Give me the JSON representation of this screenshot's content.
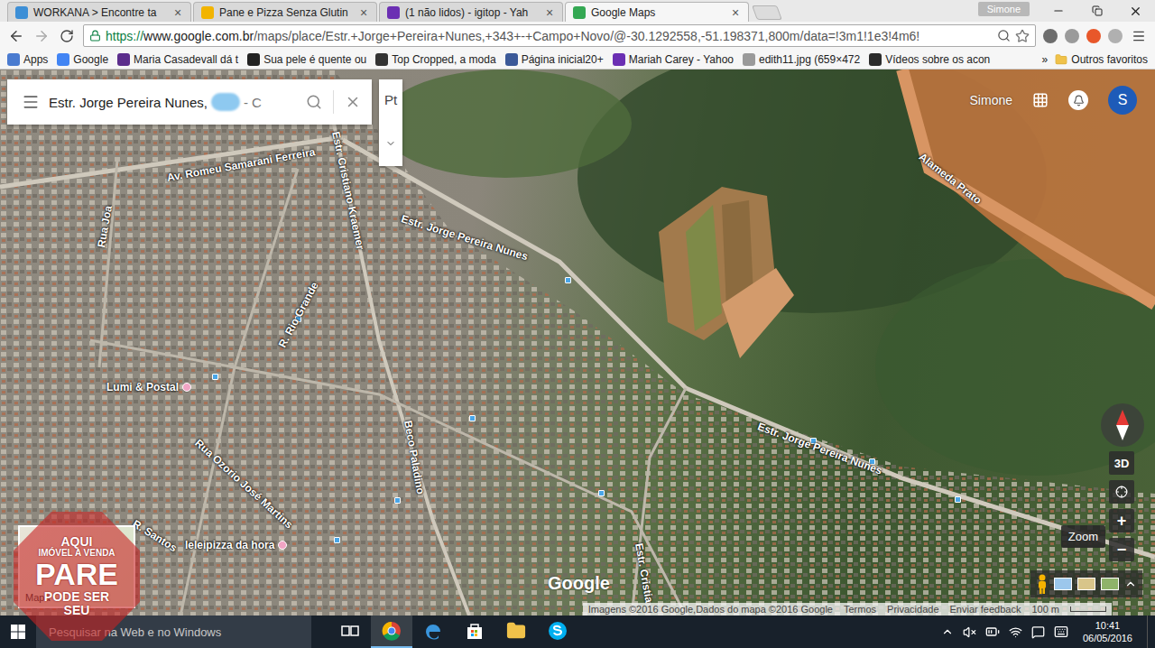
{
  "tabs": [
    {
      "label": "WORKANA > Encontre ta",
      "selected": false,
      "color": "#3d8fd6"
    },
    {
      "label": "Pane e Pizza Senza Glutin",
      "selected": false,
      "color": "#f2b400"
    },
    {
      "label": "(1 não lidos) - igitop - Yah",
      "selected": false,
      "color": "#6b2fb3"
    },
    {
      "label": "Google Maps",
      "selected": true,
      "color": "#34a853"
    }
  ],
  "tab_close": "×",
  "profile": "Simone",
  "address_bar": {
    "scheme": "https://",
    "host": "www.google.com.br",
    "path": "/maps/place/Estr.+Jorge+Pereira+Nunes,+343+-+Campo+Novo/@-30.1292558,-51.198371,800m/data=!3m1!1e3!4m6!"
  },
  "bookmarks": [
    {
      "label": "Apps",
      "color": "#4a7bd0"
    },
    {
      "label": "Google",
      "color": "#4285f4"
    },
    {
      "label": "Maria Casadevall dá t",
      "color": "#5b2d8c"
    },
    {
      "label": "Sua pele é quente ou",
      "color": "#222222"
    },
    {
      "label": "Top Cropped, a moda",
      "color": "#333333"
    },
    {
      "label": "Página inicial20+",
      "color": "#3b5998"
    },
    {
      "label": "Mariah Carey - Yahoo",
      "color": "#6b2fb3"
    },
    {
      "label": "edith11.jpg (659×472",
      "color": "#9a9a9a"
    },
    {
      "label": "Vídeos sobre os acon",
      "color": "#2b2b2b"
    }
  ],
  "bookmarks_more": "»",
  "other_bookmarks": "Outros favoritos",
  "map": {
    "search": {
      "value": "Estr. Jorge Pereira Nunes,",
      "suffix": "- C"
    },
    "language": "Pt",
    "account": {
      "name": "Simone",
      "initial": "S"
    },
    "labels": [
      {
        "text": "Av. Romeu Samarani Ferreira",
        "kind": "road"
      },
      {
        "text": "Rua Joa",
        "kind": "road"
      },
      {
        "text": "Estr. Jorge Pereira Nunes",
        "kind": "road"
      },
      {
        "text": "Alameda Prato",
        "kind": "road"
      },
      {
        "text": "R. Rio Grande",
        "kind": "road"
      },
      {
        "text": "Estr. Cristiano Kraemer",
        "kind": "road"
      },
      {
        "text": "Lumi & Postal",
        "kind": "place"
      },
      {
        "text": "Rua Ozorio José Martins",
        "kind": "road"
      },
      {
        "text": "Beco Paladino",
        "kind": "road"
      },
      {
        "text": "R. Santos",
        "kind": "road"
      },
      {
        "text": "Estr. Jorge Pereira Nunes",
        "kind": "road"
      },
      {
        "text": "leleipizza da hora",
        "kind": "place"
      },
      {
        "text": "Estr. Cristia",
        "kind": "road"
      }
    ],
    "tilt": "3D",
    "zoom_tooltip": "Zoom",
    "zoom_in": "+",
    "zoom_out": "−",
    "thumbnail": "Mapa",
    "logo": "Google",
    "footer": [
      "Imagens ©2016 Google,Dados do mapa ©2016 Google",
      "Termos",
      "Privacidade",
      "Enviar feedback"
    ],
    "scale": "100 m"
  },
  "watermark": [
    "AQUI",
    "IMÓVEL A VENDA",
    "PARE",
    "PODE SER",
    "SEU"
  ],
  "taskbar": {
    "search_placeholder": "Pesquisar na Web e no Windows",
    "apps": [
      {
        "kind": "taskview",
        "selected": false
      },
      {
        "kind": "chrome",
        "selected": true
      },
      {
        "kind": "edge",
        "selected": false
      },
      {
        "kind": "store",
        "selected": false
      },
      {
        "kind": "explorer",
        "selected": false
      },
      {
        "kind": "skype",
        "selected": false
      }
    ],
    "time": "10:41",
    "date": "06/05/2016"
  }
}
